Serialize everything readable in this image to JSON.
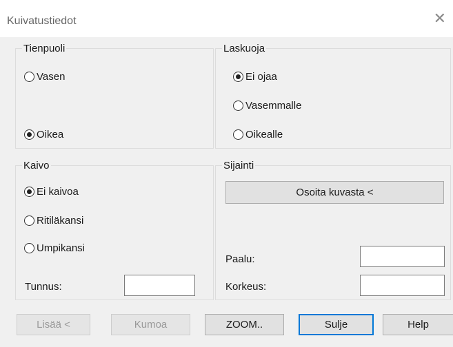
{
  "window": {
    "title": "Kuivatustiedot"
  },
  "groups": {
    "tienpuoli": {
      "label": "Tienpuoli",
      "options": [
        {
          "label": "Vasen",
          "checked": false
        },
        {
          "label": "Oikea",
          "checked": true
        }
      ]
    },
    "laskuoja": {
      "label": "Laskuoja",
      "options": [
        {
          "label": "Ei ojaa",
          "checked": true
        },
        {
          "label": "Vasemmalle",
          "checked": false
        },
        {
          "label": "Oikealle",
          "checked": false
        }
      ]
    },
    "kaivo": {
      "label": "Kaivo",
      "options": [
        {
          "label": "Ei kaivoa",
          "checked": true
        },
        {
          "label": "Ritiläkansi",
          "checked": false
        },
        {
          "label": "Umpikansi",
          "checked": false
        }
      ],
      "tunnus_label": "Tunnus:",
      "tunnus_value": ""
    },
    "sijainti": {
      "label": "Sijainti",
      "osoita_button": "Osoita kuvasta <",
      "paalu_label": "Paalu:",
      "paalu_value": "",
      "korkeus_label": "Korkeus:",
      "korkeus_value": ""
    }
  },
  "buttons": {
    "lisaa": "Lisää <",
    "kumoa": "Kumoa",
    "zoom": "ZOOM..",
    "sulje": "Sulje",
    "help": "Help"
  }
}
